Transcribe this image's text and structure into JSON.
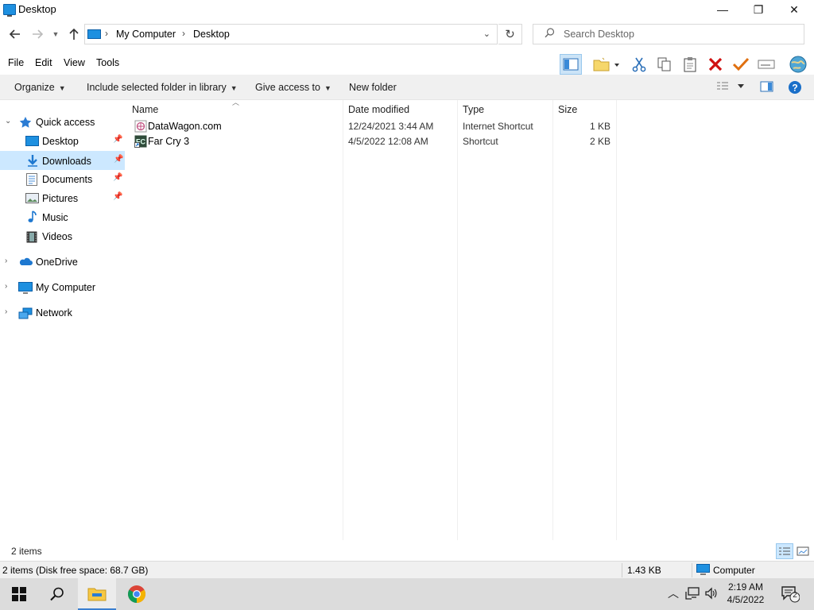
{
  "window": {
    "title": "Desktop",
    "minimize_glyph": "—",
    "maximize_glyph": "❐",
    "close_glyph": "✕"
  },
  "address": {
    "crumbs": [
      "My Computer",
      "Desktop"
    ],
    "search_placeholder": "Search Desktop"
  },
  "menu": [
    "File",
    "Edit",
    "View",
    "Tools"
  ],
  "toolbar_icons": [
    "preview-pane-icon",
    "new-folder-icon",
    "cut-icon",
    "copy-icon",
    "paste-icon",
    "delete-icon",
    "checkmark-icon",
    "rename-icon",
    "globe-icon"
  ],
  "commands": {
    "organize": "Organize",
    "include_library": "Include selected folder in library",
    "give_access": "Give access to",
    "new_folder": "New folder"
  },
  "nav": {
    "quick_access": "Quick access",
    "items": [
      {
        "label": "Desktop",
        "icon": "desktop-icon",
        "pinned": true
      },
      {
        "label": "Downloads",
        "icon": "downloads-icon",
        "pinned": true,
        "selected": true
      },
      {
        "label": "Documents",
        "icon": "documents-icon",
        "pinned": true
      },
      {
        "label": "Pictures",
        "icon": "pictures-icon",
        "pinned": true
      },
      {
        "label": "Music",
        "icon": "music-icon",
        "pinned": false
      },
      {
        "label": "Videos",
        "icon": "videos-icon",
        "pinned": false
      }
    ],
    "onedrive": "OneDrive",
    "my_computer": "My Computer",
    "network": "Network"
  },
  "columns": {
    "name": "Name",
    "date": "Date modified",
    "type": "Type",
    "size": "Size"
  },
  "files": [
    {
      "name": "DataWagon.com",
      "date": "12/24/2021 3:44 AM",
      "type": "Internet Shortcut",
      "size": "1 KB",
      "icon": "internet-shortcut-icon"
    },
    {
      "name": "Far Cry 3",
      "date": "4/5/2022 12:08 AM",
      "type": "Shortcut",
      "size": "2 KB",
      "icon": "shortcut-icon"
    }
  ],
  "status": {
    "item_count": "2 items",
    "details_left": "2 items (Disk free space: 68.7 GB)",
    "details_size": "1.43 KB",
    "details_location": "Computer"
  },
  "taskbar": {
    "time": "2:19 AM",
    "date": "4/5/2022",
    "notification_count": "2"
  },
  "colors": {
    "accent": "#1e90e0",
    "selection": "#cce8ff",
    "delete_red": "#d01010",
    "check_orange": "#e07010"
  }
}
